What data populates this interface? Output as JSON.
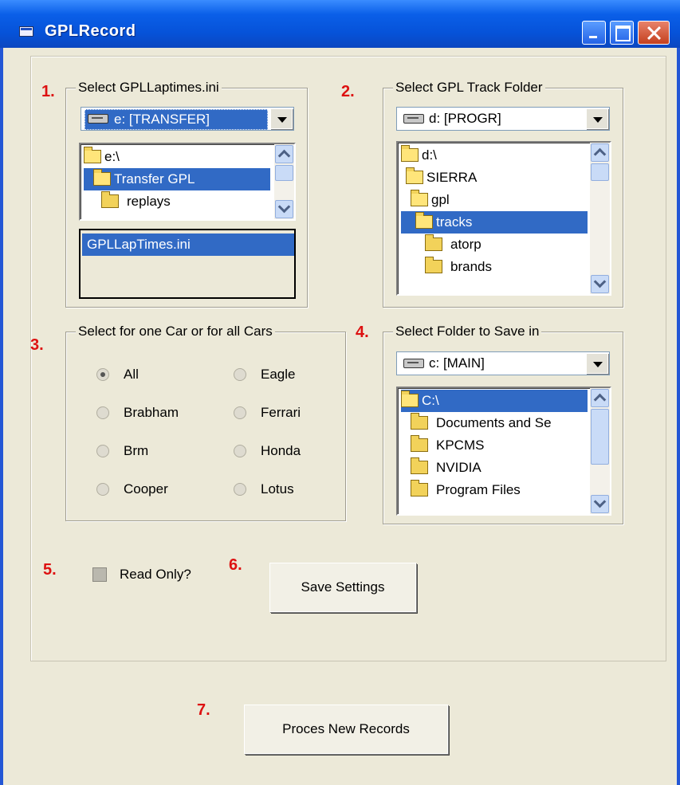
{
  "window": {
    "title": "GPLRecord"
  },
  "steps": [
    "1.",
    "2.",
    "3.",
    "4.",
    "5.",
    "6.",
    "7."
  ],
  "group1": {
    "label": "Select GPLLaptimes.ini",
    "drive": "e: [TRANSFER]",
    "dirs": [
      "e:\\",
      "Transfer GPL",
      "replays"
    ],
    "selected_dir": "Transfer GPL",
    "files": [
      "GPLLapTimes.ini"
    ]
  },
  "group2": {
    "label": "Select GPL Track Folder",
    "drive": "d: [PROGR]",
    "dirs": [
      "d:\\",
      "SIERRA",
      "gpl",
      "tracks",
      "atorp",
      "brands"
    ],
    "selected_dir": "tracks"
  },
  "group3": {
    "label": "Select for one Car or for all Cars",
    "options": [
      "All",
      "Brabham",
      "Brm",
      "Cooper",
      "Eagle",
      "Ferrari",
      "Honda",
      "Lotus"
    ],
    "selected": "All"
  },
  "group4": {
    "label": "Select Folder to Save in",
    "drive": "c: [MAIN]",
    "dirs": [
      "C:\\",
      "Documents and Se",
      "KPCMS",
      "NVIDIA",
      "Program Files"
    ],
    "selected_dir": "C:\\"
  },
  "read_only": {
    "label": "Read Only?",
    "checked": false
  },
  "buttons": {
    "save": "Save Settings",
    "process": "Proces New Records"
  }
}
